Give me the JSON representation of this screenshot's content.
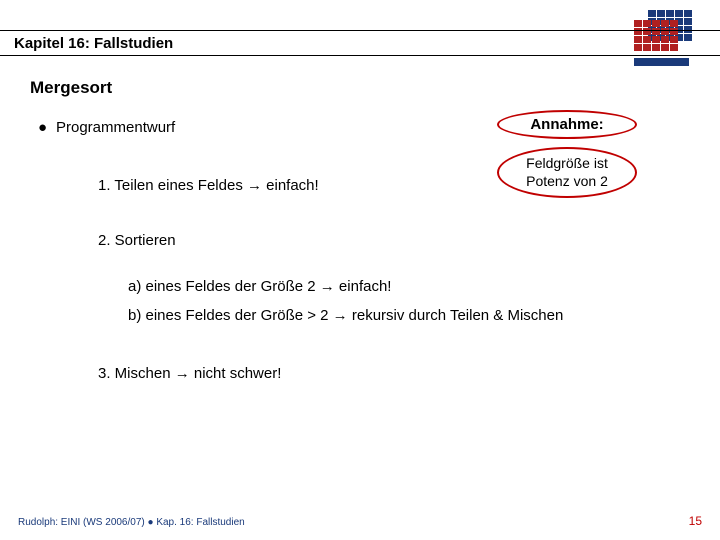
{
  "chapter_title": "Kapitel 16: Fallstudien",
  "section_title": "Mergesort",
  "bullet_label": "Programmentwurf",
  "items": {
    "one": "1.   Teilen eines Feldes → einfach!",
    "two": "2.   Sortieren",
    "two_a": "a)  eines Feldes der Größe 2      → einfach!",
    "two_b": "b)  eines Feldes der Größe > 2 → rekursiv durch Teilen & Mischen",
    "three": "3.   Mischen → nicht schwer!"
  },
  "callout": {
    "title": "Annahme:",
    "sub": "Feldgröße ist Potenz von 2"
  },
  "footer_left": "Rudolph: EINI (WS 2006/07)  ●  Kap. 16: Fallstudien",
  "page_number": "15"
}
